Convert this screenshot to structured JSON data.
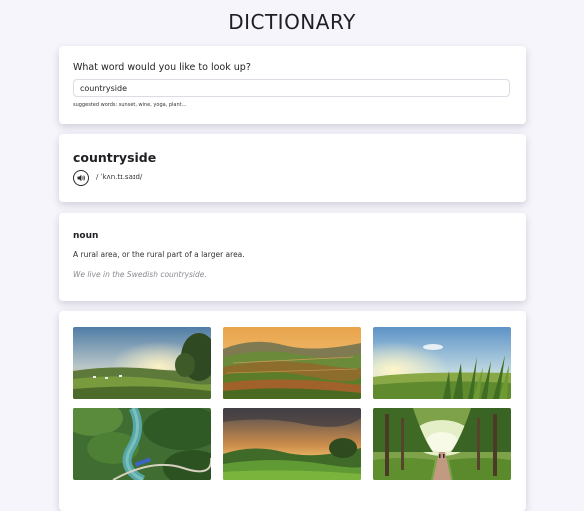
{
  "app": {
    "title": "DICTIONARY"
  },
  "search": {
    "question": "What word would you like to look up?",
    "value": "countryside",
    "suggestions": "suggested words: sunset, wine, yoga, plant..."
  },
  "result": {
    "word": "countryside",
    "phonetic": "/ ˈkʌn.tɪ.saɪd/",
    "audio_icon": "speaker-icon"
  },
  "meaning": {
    "part_of_speech": "noun",
    "definition": "A rural area, or the rural part of a larger area.",
    "example": "We live in the Swedish countryside."
  },
  "gallery": {
    "photos": [
      {
        "subject": "pasture-at-sunset"
      },
      {
        "subject": "terraced-hills"
      },
      {
        "subject": "sunlit-grass"
      },
      {
        "subject": "river-valley-aerial"
      },
      {
        "subject": "green-hills-sunset"
      },
      {
        "subject": "tree-lined-road"
      }
    ]
  },
  "colors": {
    "background": "#f6f5fb",
    "card": "#ffffff",
    "text": "#1f1f24",
    "example_text": "#8a8a92"
  }
}
